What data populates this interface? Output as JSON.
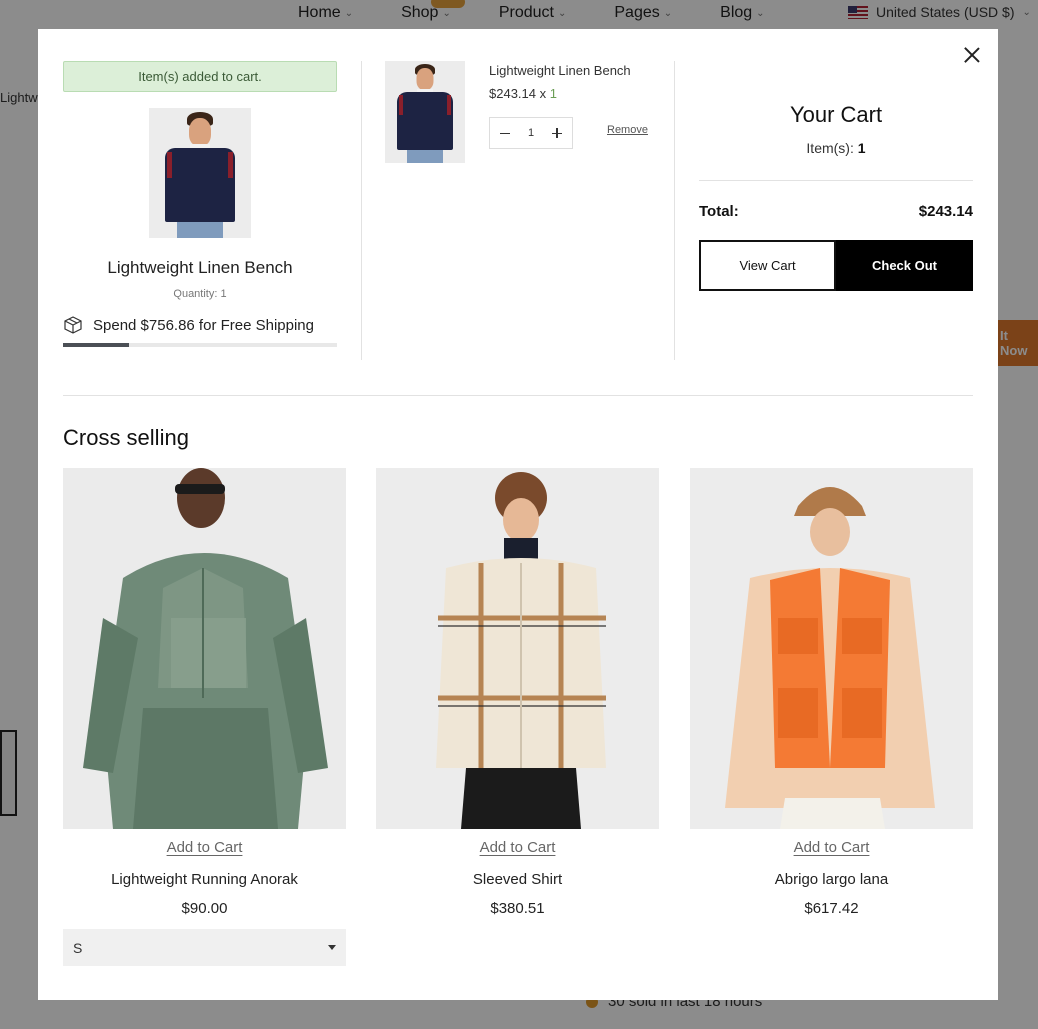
{
  "background": {
    "nav": [
      {
        "label": "Home"
      },
      {
        "label": "Shop"
      },
      {
        "label": "Product"
      },
      {
        "label": "Pages"
      },
      {
        "label": "Blog"
      }
    ],
    "locale": "United States (USD $)",
    "breadcrumb": "Lightw",
    "cta_fragment": "It Now",
    "sold_note": "30 sold in last 18 hours"
  },
  "added": {
    "banner": "Item(s) added to cart.",
    "product_name": "Lightweight Linen Bench",
    "quantity_label": "Quantity: 1",
    "shipping_text": "Spend $756.86 for Free Shipping",
    "shipping_progress": 0.24
  },
  "line_item": {
    "name": "Lightweight Linen Bench",
    "price": "$243.14 x ",
    "qty_suffix": "1",
    "quantity": "1",
    "remove_label": "Remove"
  },
  "cart": {
    "title": "Your Cart",
    "count_label": "Item(s): ",
    "count_value": "1",
    "total_label": "Total:",
    "total_value": "$243.14",
    "view_cart_label": "View Cart",
    "checkout_label": "Check Out"
  },
  "cross_selling": {
    "title": "Cross selling",
    "products": [
      {
        "add_label": "Add to Cart",
        "name": "Lightweight Running Anorak",
        "price": "$90.00",
        "size": "S"
      },
      {
        "add_label": "Add to Cart",
        "name": "Sleeved Shirt",
        "price": "$380.51"
      },
      {
        "add_label": "Add to Cart",
        "name": "Abrigo largo lana",
        "price": "$617.42"
      }
    ]
  },
  "colors": {
    "banner_bg": "#dcefd8",
    "checkout_bg": "#000000",
    "accent_qty": "#6a9e55"
  }
}
